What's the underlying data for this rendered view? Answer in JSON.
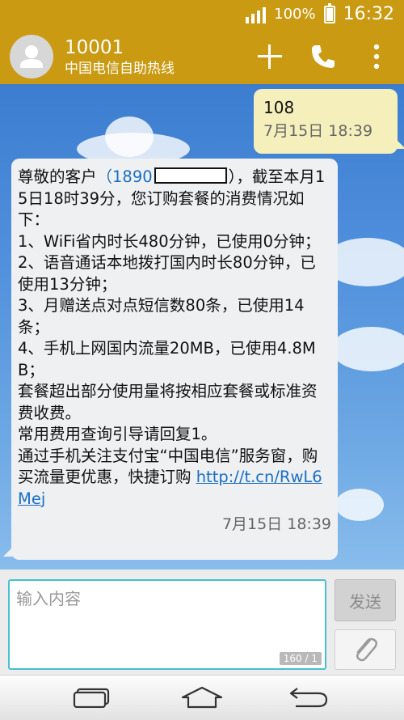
{
  "status_bar": {
    "battery_percent": "100%",
    "time": "16:32",
    "signal_level": 4
  },
  "header": {
    "contact_number": "10001",
    "contact_name": "中国电信自助热线",
    "icons": [
      "add-icon",
      "phone-icon",
      "overflow-menu-icon"
    ]
  },
  "messages": {
    "outgoing": {
      "text": "108",
      "time": "7月15日 18:39"
    },
    "incoming": {
      "greeting_prefix": "尊敬的客户",
      "phone_link": "（1890",
      "body_after_phone": "），截至本月15日18时39分，您订购套餐的消费情况如下：\n1、WiFi省内时长480分钟，已使用0分钟；\n2、语音通话本地拨打国内时长80分钟，已使用13分钟；\n3、月赠送点对点短信数80条，已使用14条；\n4、手机上网国内流量20MB，已使用4.8MB；\n套餐超出部分使用量将按相应套餐或标准资费收费。\n常用费用查询引导请回复1。\n通过手机关注支付宝“中国电信”服务窗，购买流量更优惠，快捷订购 ",
      "url": "http://t.cn/RwL6Mej",
      "time": "7月15日 18:39"
    }
  },
  "compose": {
    "placeholder": "输入内容",
    "counter": "160 / 1",
    "send_label": "发送"
  },
  "colors": {
    "header_bg": "#c99a12",
    "outgoing_bubble": "#f5efbc",
    "incoming_bubble": "#eef0f2",
    "link": "#1a6fc4",
    "input_border": "#49bfd2"
  },
  "nav_bar": {
    "icons": [
      "recent-apps-icon",
      "home-icon",
      "back-icon"
    ]
  }
}
